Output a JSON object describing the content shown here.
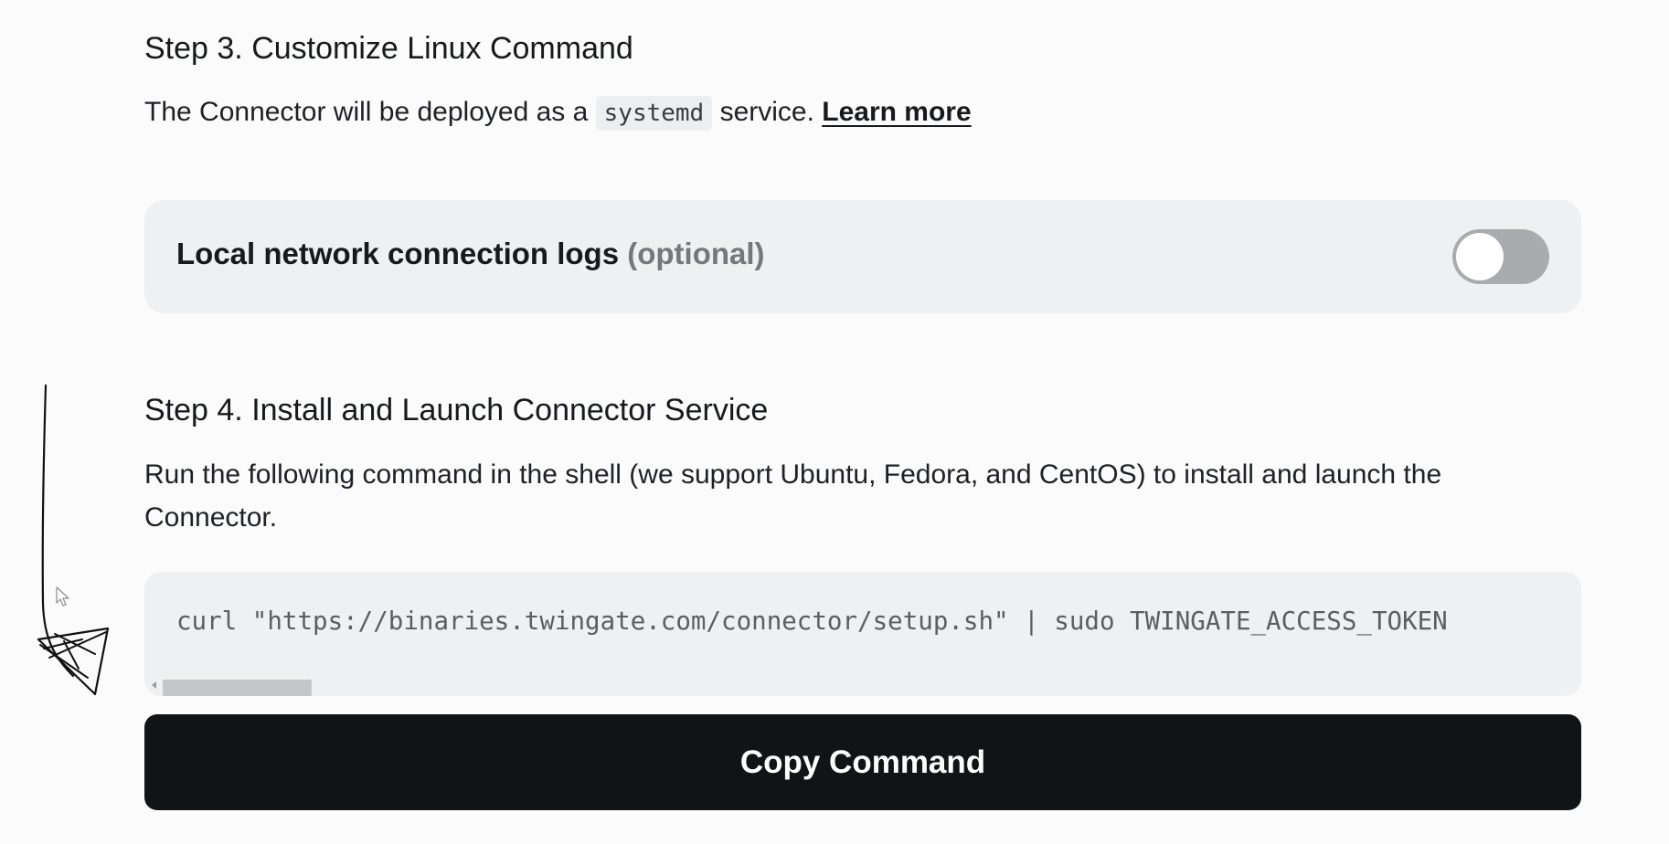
{
  "step3": {
    "heading": "Step 3. Customize Linux Command",
    "description_prefix": "The Connector will be deployed as a",
    "code_term": "systemd",
    "description_suffix": "service.",
    "learn_more_label": "Learn more"
  },
  "logs_option": {
    "label": "Local network connection logs",
    "optional_label": "(optional)",
    "toggle_state": "off"
  },
  "step4": {
    "heading": "Step 4. Install and Launch Connector Service",
    "description": "Run the following command in the shell (we support Ubuntu, Fedora, and CentOS) to install and launch the Connector.",
    "command": "curl \"https://binaries.twingate.com/connector/setup.sh\" | sudo TWINGATE_ACCESS_TOKEN"
  },
  "copy_button_label": "Copy Command",
  "colors": {
    "button_bg": "#111315",
    "panel_bg": "#eef0f1",
    "toggle_off": "#a9abaf"
  },
  "icons": {
    "annotation": "hand-drawn-arrow-icon",
    "pointer": "mouse-pointer-icon"
  }
}
